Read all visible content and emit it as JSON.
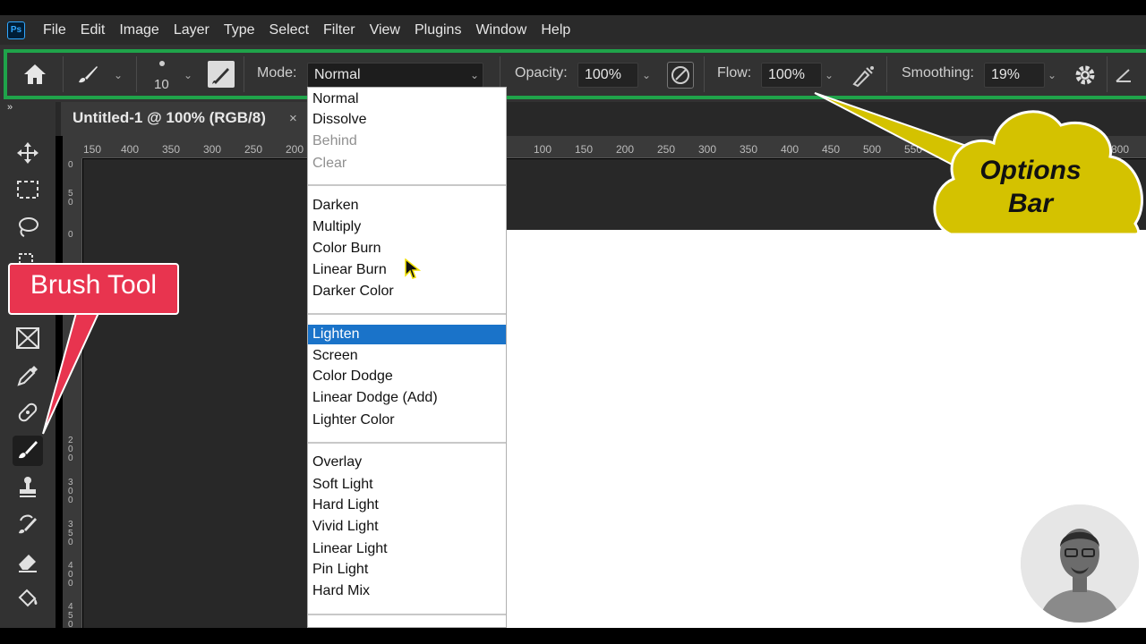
{
  "app": {
    "logo_text": "Ps"
  },
  "menu": {
    "items": [
      "File",
      "Edit",
      "Image",
      "Layer",
      "Type",
      "Select",
      "Filter",
      "View",
      "Plugins",
      "Window",
      "Help"
    ]
  },
  "options_bar": {
    "brush_size": "10",
    "mode_label": "Mode:",
    "mode_value": "Normal",
    "opacity_label": "Opacity:",
    "opacity_value": "100%",
    "flow_label": "Flow:",
    "flow_value": "100%",
    "smoothing_label": "Smoothing:",
    "smoothing_value": "19%",
    "frame_color": "#1fa34a"
  },
  "document": {
    "tab_title": "Untitled-1 @ 100% (RGB/8)",
    "close": "×"
  },
  "ruler": {
    "h_ticks": [
      "150",
      "400",
      "350",
      "300",
      "250",
      "200",
      "100",
      "150",
      "200",
      "250",
      "300",
      "350",
      "400",
      "450",
      "500",
      "550",
      "800"
    ],
    "v_ticks": [
      "0",
      "5\n0",
      "0",
      "5\n0",
      "0",
      "5\n0",
      "2\n0\n0",
      "2\n5\n0",
      "3\n0\n0",
      "3\n5\n0",
      "4\n0\n0",
      "4\n5\n0"
    ]
  },
  "blend_modes": {
    "selected": "Lighten",
    "groups": [
      [
        {
          "label": "Normal"
        },
        {
          "label": "Dissolve"
        },
        {
          "label": "Behind",
          "disabled": true
        },
        {
          "label": "Clear",
          "disabled": true
        }
      ],
      [
        {
          "label": "Darken"
        },
        {
          "label": "Multiply"
        },
        {
          "label": "Color Burn"
        },
        {
          "label": "Linear Burn"
        },
        {
          "label": "Darker Color"
        }
      ],
      [
        {
          "label": "Lighten"
        },
        {
          "label": "Screen"
        },
        {
          "label": "Color Dodge"
        },
        {
          "label": "Linear Dodge (Add)"
        },
        {
          "label": "Lighter Color"
        }
      ],
      [
        {
          "label": "Overlay"
        },
        {
          "label": "Soft Light"
        },
        {
          "label": "Hard Light"
        },
        {
          "label": "Vivid Light"
        },
        {
          "label": "Linear Light"
        },
        {
          "label": "Pin Light"
        },
        {
          "label": "Hard Mix"
        }
      ]
    ]
  },
  "tools": [
    "move-icon",
    "marquee-icon",
    "lasso-icon",
    "crop-icon",
    "frame-icon",
    "eyedropper-icon",
    "healing-icon",
    "brush-icon",
    "stamp-icon",
    "history-brush-icon",
    "eraser-icon",
    "paint-bucket-icon"
  ],
  "annotations": {
    "brush_tool": "Brush Tool",
    "options_bar_line1": "Options",
    "options_bar_line2": "Bar",
    "brush_color": "#e8344f",
    "options_color": "#d4c200"
  }
}
